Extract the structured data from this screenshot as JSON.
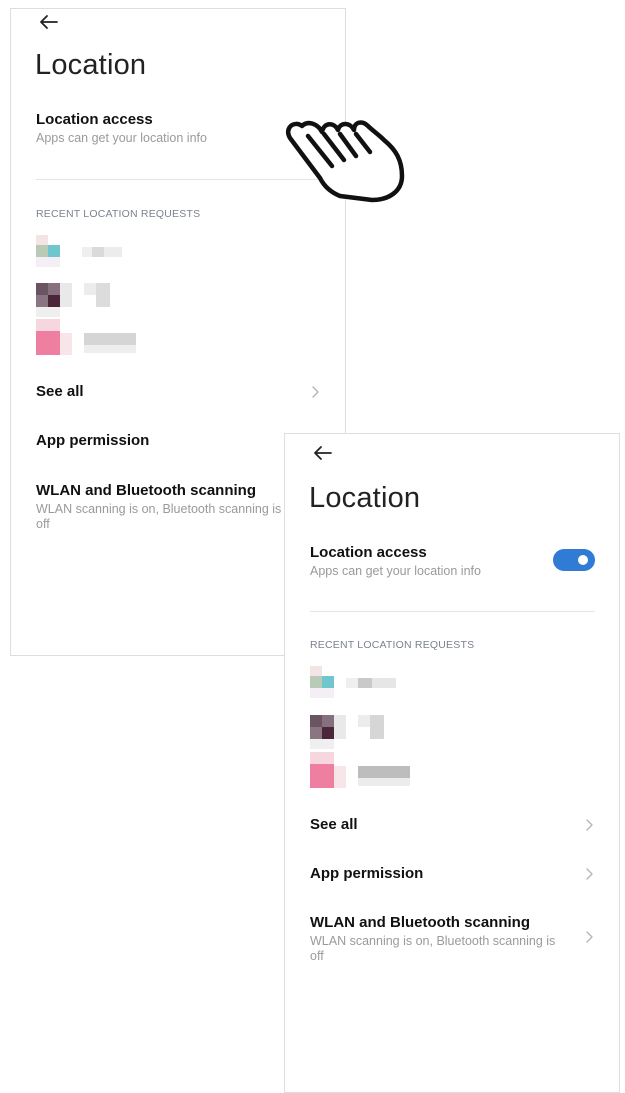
{
  "colors": {
    "toggle_on": "#2f7bd6",
    "toggle_off": "#e6e6e6",
    "accent_label": "#7b8190"
  },
  "before": {
    "title": "Location",
    "location_access": {
      "title": "Location access",
      "subtitle": "Apps can get your location info",
      "toggle_state": "off"
    },
    "recent_header": "RECENT LOCATION REQUESTS",
    "see_all": "See all",
    "app_permission": "App permission",
    "wlan": {
      "title": "WLAN and Bluetooth scanning",
      "subtitle": "WLAN scanning is on, Bluetooth scanning is off"
    }
  },
  "after": {
    "title": "Location",
    "location_access": {
      "title": "Location access",
      "subtitle": "Apps can get your location info",
      "toggle_state": "on"
    },
    "recent_header": "RECENT LOCATION REQUESTS",
    "see_all": "See all",
    "app_permission": "App permission",
    "wlan": {
      "title": "WLAN and Bluetooth scanning",
      "subtitle": "WLAN scanning is on, Bluetooth scanning is off"
    }
  },
  "icons": {
    "back": "back-arrow-icon",
    "chevron": "chevron-right-icon",
    "hand": "tap-hand-icon"
  }
}
